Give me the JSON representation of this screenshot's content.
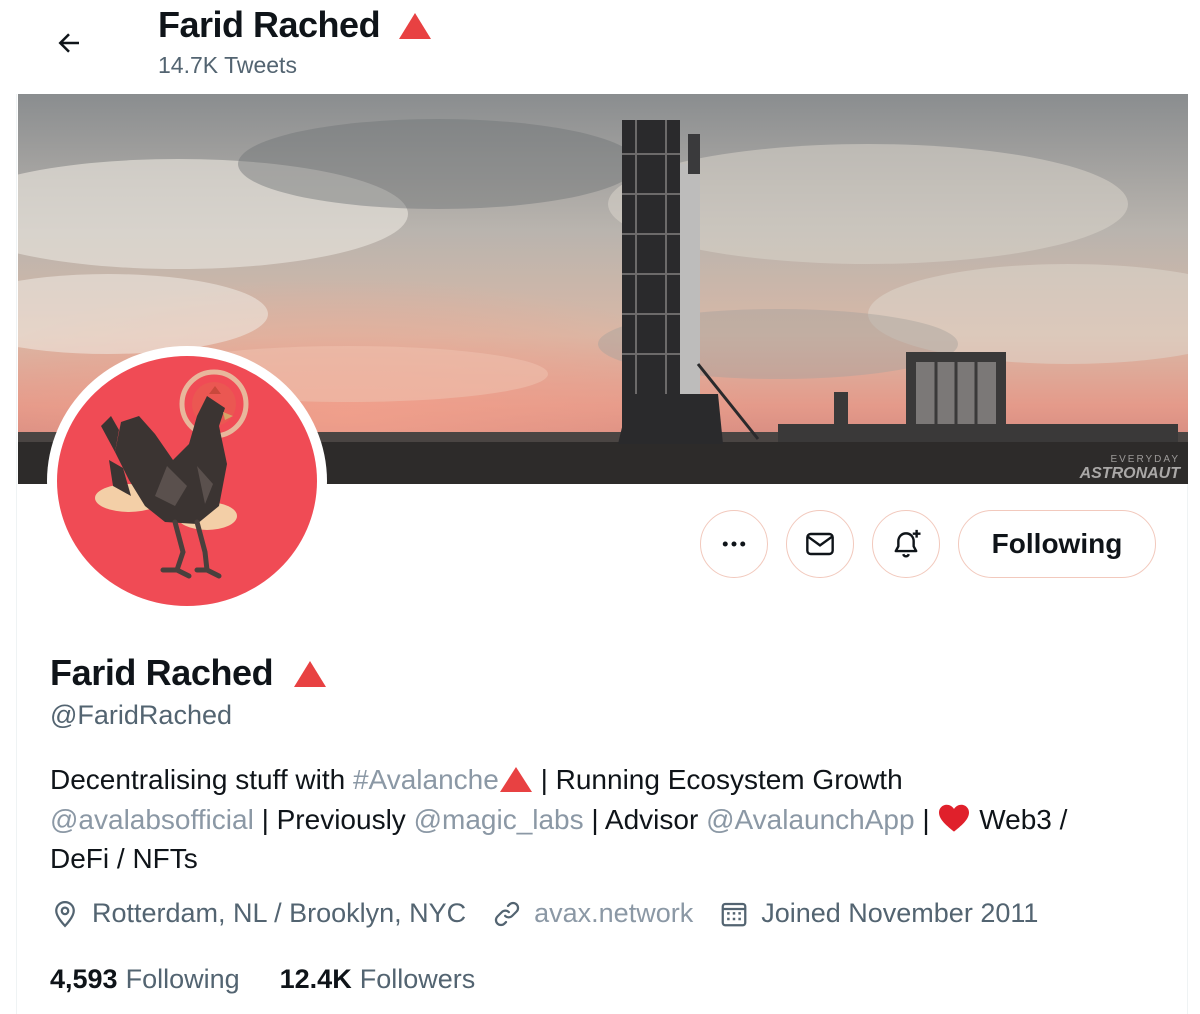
{
  "header": {
    "name": "Farid Rached",
    "tweet_count": "14.7K Tweets"
  },
  "banner": {
    "watermark_line1": "EVERYDAY",
    "watermark_line2": "ASTRONAUT"
  },
  "actions": {
    "follow_label": "Following",
    "more_icon": "more-icon",
    "message_icon": "mail-icon",
    "notify_icon": "bell-plus-icon"
  },
  "profile": {
    "name": "Farid Rached",
    "handle": "@FaridRached",
    "bio": {
      "p1": "Decentralising stuff with ",
      "hashtag": "#Avalanche",
      "p2": " | Running Ecosystem Growth",
      "mention1": "@avalabsofficial",
      "p3": " | Previously ",
      "mention2": "@magic_labs",
      "p4": " | Advisor ",
      "mention3": "@AvalaunchApp",
      "p5": " | ",
      "p6": " Web3 /",
      "p7": "DeFi / NFTs"
    },
    "location": "Rotterdam, NL / Brooklyn, NYC",
    "website": "avax.network",
    "joined": "Joined November 2011",
    "following_count": "4,593",
    "following_label": "Following",
    "followers_count": "12.4K",
    "followers_label": "Followers"
  },
  "colors": {
    "accent": "#e84142",
    "avatar_bg": "#f04b55",
    "link": "#8b98a5",
    "secondary_text": "#536471"
  }
}
